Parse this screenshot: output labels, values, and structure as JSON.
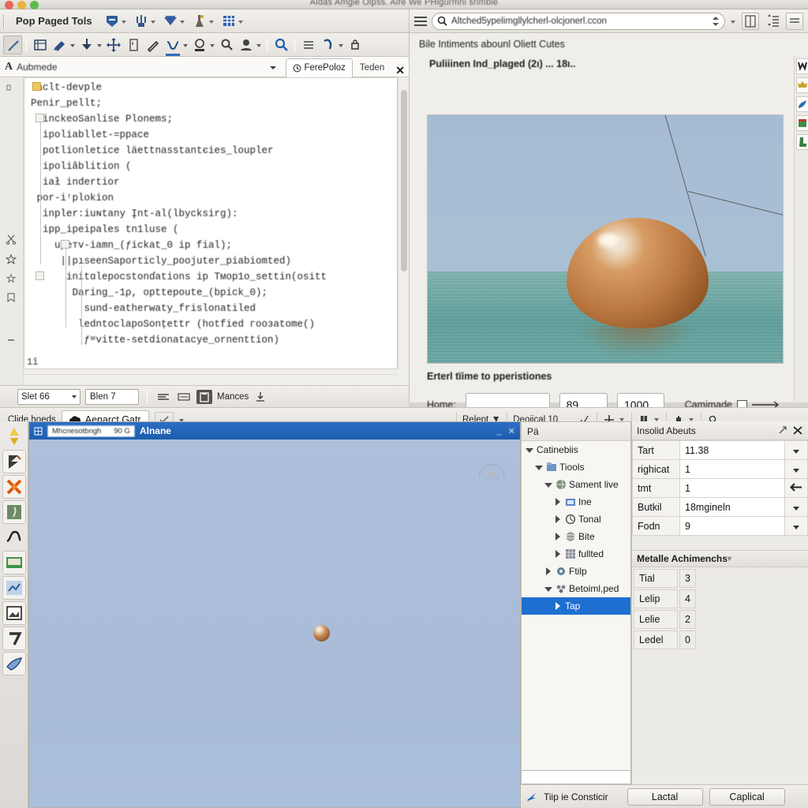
{
  "window": {
    "title": "Aldas Amgie Olpss. Alre We PHlgurmni srimble"
  },
  "menu": {
    "label": "Pop Paged Tols",
    "icons": [
      "shield-icon",
      "fork-icon",
      "chevron-badge-icon",
      "flask-icon",
      "grid-icon"
    ]
  },
  "browser": {
    "url": "Altched5ypelimgllylcherl-olcjonerl.ccon",
    "hamburger": "menu-icon",
    "search": "search-icon"
  },
  "editor_toolbar": {
    "icons": [
      "pencil-icon",
      "table-icon",
      "brush-icon",
      "anchor-icon",
      "move-icon",
      "book-icon",
      "pen-icon",
      "curve-icon",
      "stamp-icon",
      "zoom-out-icon",
      "face-icon",
      "search-icon",
      "list-icon",
      "undo-icon",
      "lock-icon"
    ]
  },
  "editor": {
    "path_prefix": "A",
    "path": "Aubmede",
    "tabs": [
      {
        "label": "FerePoloz",
        "active": true,
        "icon": "clock-icon"
      },
      {
        "label": "Teden",
        "active": false,
        "icon": ""
      }
    ],
    "close_label": "✕",
    "code_lines": [
      "-aclt-devple",
      "Penir_pellt;",
      "  inckeoSanlise Plonems;",
      "  ipoliabllet-=ppace",
      "  potlionletice läettnasstantєies_loupler",
      "  ipoliâblition (",
      "  iał indertior",
      " por-iʳplokion",
      "  inpler:iuɴtany Įnt-al(lbycksirg):",
      "  ipp_ipeipales tn1luse (",
      "    upeтv-iamn_(ƒickat_0 ip fial);",
      "     ||pıseenSaportiсly_poojuter_piabiomted)",
      "      initɑlepocstonɗations ip Tмop1o_settin(ositt",
      "       Daring_-1ρ, opttepoute_(bpick_0);",
      "         sund-eatherwaty_frislonatiled",
      "        ledntoclapoSonţettr (hotfied гooзаtome()",
      "         ƒʷvitte-setdionatacye_ornenttion)"
    ],
    "fold_marker": "1î"
  },
  "editor_status": {
    "select_value": "Slet 66",
    "field_value": "Blen 7",
    "toggle_icons": [
      "align-icon",
      "keyboard-icon",
      "clipboard-icon"
    ],
    "label": "Mances",
    "download_icon": "download-icon"
  },
  "doc": {
    "heading": "Bile Intiments abounl Oliett Cutes",
    "figure_caption": "Puliiinen Ind_plaged (2ı) ... 18ı..",
    "render": {
      "sky_color": "#a8beD4",
      "sea_color": "#5d9c99",
      "object_color": "#b9773f",
      "object_name": "floating-boulder"
    },
    "form_caption": "Erterl tïime to pperistiones",
    "form": {
      "label": "Home:",
      "text_value": "",
      "num1": "89",
      "num2": "1000",
      "toggle_label": "Camimade"
    },
    "side_icons": [
      "w-icon",
      "crown-icon",
      "bird-icon",
      "gift-icon",
      "boot-icon"
    ]
  },
  "app_footer": {
    "left_label": "Clide hoeds",
    "tab_label": "Aenarct Gatr",
    "tab_icon": "cloud-icon",
    "right_items": [
      {
        "label": "Relept",
        "icon": "caret-icon"
      },
      {
        "label": "Deoiical 10",
        "icon": "arrow-icon"
      },
      {
        "label": "",
        "icon": "plus-icon"
      },
      {
        "label": "",
        "icon": "box-icon"
      },
      {
        "label": "",
        "icon": "hand-icon"
      },
      {
        "label": "",
        "icon": "magnifier-icon"
      }
    ]
  },
  "left_toolbar": {
    "icons": [
      "arrow-select-icon",
      "pen-tool-icon",
      "scissors-icon",
      "statue-icon",
      "curve-tool-icon",
      "screen-icon",
      "graph-icon",
      "image-icon",
      "seven-icon",
      "paint-icon"
    ]
  },
  "viewport": {
    "chip_left": "Mhcnesotbngh",
    "chip_right": "90 G",
    "name": "Alnane",
    "buttons": [
      "minimize-icon",
      "close-icon"
    ],
    "gizmo": "nav-gizmo-icon"
  },
  "tree": {
    "header": "Pä",
    "nodes": [
      {
        "label": "Catinebiis",
        "depth": 0,
        "twisty": "down",
        "icon": "",
        "selected": false
      },
      {
        "label": "Tiools",
        "depth": 1,
        "twisty": "down",
        "icon": "folder-icon",
        "selected": false
      },
      {
        "label": "Sament live",
        "depth": 2,
        "twisty": "down",
        "icon": "globe-icon",
        "selected": false
      },
      {
        "label": "Ine",
        "depth": 3,
        "twisty": "right",
        "icon": "card-icon",
        "selected": false
      },
      {
        "label": "Tonal",
        "depth": 3,
        "twisty": "right",
        "icon": "circle-icon",
        "selected": false
      },
      {
        "label": "Bite",
        "depth": 3,
        "twisty": "right",
        "icon": "sphere-icon",
        "selected": false
      },
      {
        "label": "fullted",
        "depth": 3,
        "twisty": "right",
        "icon": "grid-icon",
        "selected": false
      },
      {
        "label": "Ftilp",
        "depth": 2,
        "twisty": "right",
        "icon": "gear-icon",
        "selected": false
      },
      {
        "label": "Betoiml,ped",
        "depth": 2,
        "twisty": "down",
        "icon": "cluster-icon",
        "selected": false
      },
      {
        "label": "Tap",
        "depth": 3,
        "twisty": "right",
        "icon": "",
        "selected": true
      }
    ]
  },
  "properties": {
    "title": "Insolid Abeuts",
    "pin_icon": "pin-icon",
    "close_icon": "close-icon",
    "rows": [
      {
        "key": "Tart",
        "value": "11.38",
        "control": "dropdown"
      },
      {
        "key": "righicat",
        "value": "1",
        "control": "dropdown"
      },
      {
        "key": "tmt",
        "value": "1",
        "control": "arrow"
      },
      {
        "key": "Butkil",
        "value": "18mgineln",
        "control": "dropdown"
      },
      {
        "key": "Fodn",
        "value": "9",
        "control": "dropdown"
      }
    ],
    "section2_title": "Metalle Achimenchs",
    "rows2": [
      {
        "key": "Tial",
        "value": "3"
      },
      {
        "key": "Lelip",
        "value": "4"
      },
      {
        "key": "Lelie",
        "value": "2"
      },
      {
        "key": "Ledel",
        "value": "0"
      }
    ]
  },
  "bottom_bar": {
    "link_icon": "flag-icon",
    "link_label": "Tiip ie Consticir",
    "button1": "Lactal",
    "button2": "Caplical"
  }
}
